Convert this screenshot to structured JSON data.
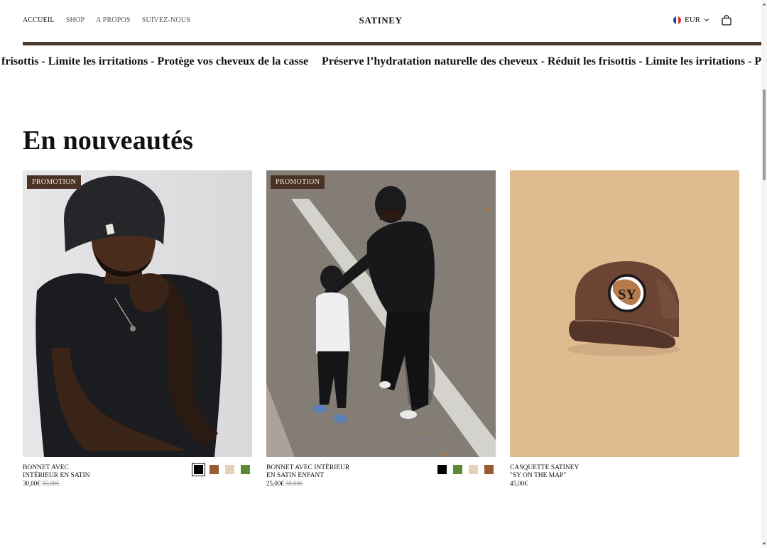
{
  "header": {
    "nav": [
      "ACCUEIL",
      "SHOP",
      "A PROPOS",
      "SUIVEZ-NOUS"
    ],
    "brand": "SATINEY",
    "currency": "EUR",
    "flag_colors": [
      "#1f3fa0",
      "#ffffff",
      "#e0342e"
    ]
  },
  "marquee": {
    "items": [
      "frisottis - Limite les irritations - Protège vos cheveux de la casse",
      "Préserve l’hydratation naturelle des cheveux - Réduit les frisottis - Limite les irritations - Prot"
    ]
  },
  "section": {
    "title": "En nouveautés"
  },
  "products": [
    {
      "badge": "PROMOTION",
      "title_line1": "BONNET AVEC",
      "title_line2": "INTÉRIEUR EN SATIN",
      "price": "30,00€",
      "old_price": "35,00€",
      "swatches": [
        "#000000",
        "#9a5a32",
        "#e5d1b5",
        "#5a8a3a"
      ],
      "selected_swatch": 0,
      "image": "man-in-black-beanie"
    },
    {
      "badge": "PROMOTION",
      "title_line1": "BONNET AVEC INTÉRIEUR",
      "title_line2": "EN SATIN ENFANT",
      "price": "25,00€",
      "old_price": "30,00€",
      "swatches": [
        "#000000",
        "#5a8a3a",
        "#e5d1b5",
        "#9a5a32"
      ],
      "selected_swatch": -1,
      "image": "father-and-child-walking"
    },
    {
      "title_line1": "CASQUETTE SATINEY",
      "title_line2": "\"SY ON THE MAP\"",
      "price": "45,00€",
      "image": "brown-cap-sy-logo"
    }
  ],
  "colors": {
    "rule": "#4a3b30",
    "badge_bg": "#4a3224",
    "cap_bg": "#dfbb90"
  }
}
